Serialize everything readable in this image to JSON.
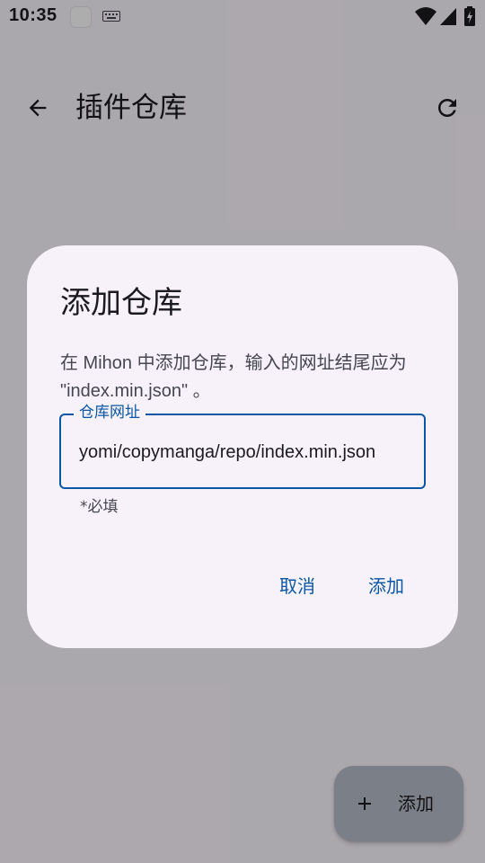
{
  "status_bar": {
    "time": "10:35"
  },
  "appbar": {
    "title": "插件仓库",
    "back_icon": "arrow-back-icon",
    "refresh_icon": "refresh-icon"
  },
  "dialog": {
    "title": "添加仓库",
    "text_line1": "在 Mihon 中添加仓库，输入的网址结尾应为",
    "text_line2": "\"index.min.json\" 。",
    "field_label": "仓库网址",
    "field_value": "yomi/copymanga/repo/index.min.json",
    "support_text": "*必填",
    "cancel_label": "取消",
    "confirm_label": "添加"
  },
  "fab": {
    "icon": "add-icon",
    "label": "添加"
  },
  "colors": {
    "accent": "#0a56a5",
    "dialog_bg": "#f7f2fa",
    "fab_bg": "#b5bbc9"
  }
}
